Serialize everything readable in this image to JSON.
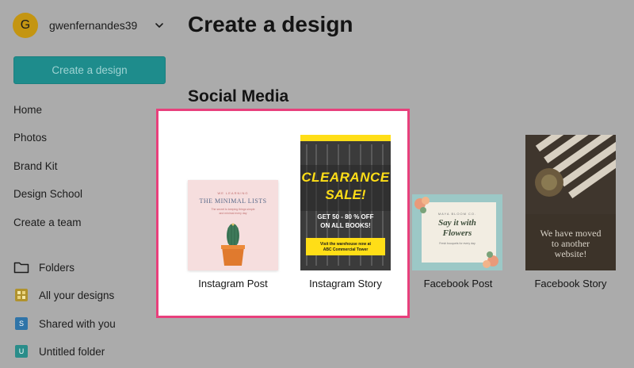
{
  "account": {
    "avatar_letter": "G",
    "username": "gwenfernandes39"
  },
  "sidebar": {
    "create_label": "Create a design",
    "nav": {
      "home": "Home",
      "photos": "Photos",
      "brand_kit": "Brand Kit",
      "design_school": "Design School",
      "create_team": "Create a team"
    },
    "folders": {
      "folders_label": "Folders",
      "all_designs": "All your designs",
      "shared": "Shared with you",
      "shared_icon_letter": "S",
      "untitled": "Untitled folder",
      "untitled_icon_letter": "U"
    }
  },
  "main": {
    "title": "Create a design",
    "section": "Social Media",
    "cards": [
      {
        "label": "Instagram Post",
        "thumb": {
          "line1": "WE LEARNING",
          "heading": "THE MINIMAL LISTS",
          "line2": "The secret to keeping things simple",
          "line3": "and minimal every day"
        }
      },
      {
        "label": "Instagram Story",
        "thumb": {
          "heading1": "CLEARANCE",
          "heading2": "SALE!",
          "offer1": "GET 50 - 80 % OFF",
          "offer2": "ON ALL BOOKS!",
          "note1": "Visit the warehouse now at",
          "note2": "ABC Commercial Tower"
        }
      },
      {
        "label": "Facebook Post",
        "thumb": {
          "line1": "MAYA BLOOM CO.",
          "heading1": "Say it with",
          "heading2": "Flowers",
          "line2": "Fresh bouquets for every day"
        }
      },
      {
        "label": "Facebook Story",
        "thumb": {
          "line1": "We have moved",
          "line2": "to another",
          "line3": "website!"
        }
      }
    ]
  },
  "colors": {
    "overlay_bg": "#ababab",
    "create_button": "#1e8c8c",
    "highlight_border": "#e8407c",
    "avatar": "#c49511",
    "clearance_yellow": "#ffde17"
  }
}
